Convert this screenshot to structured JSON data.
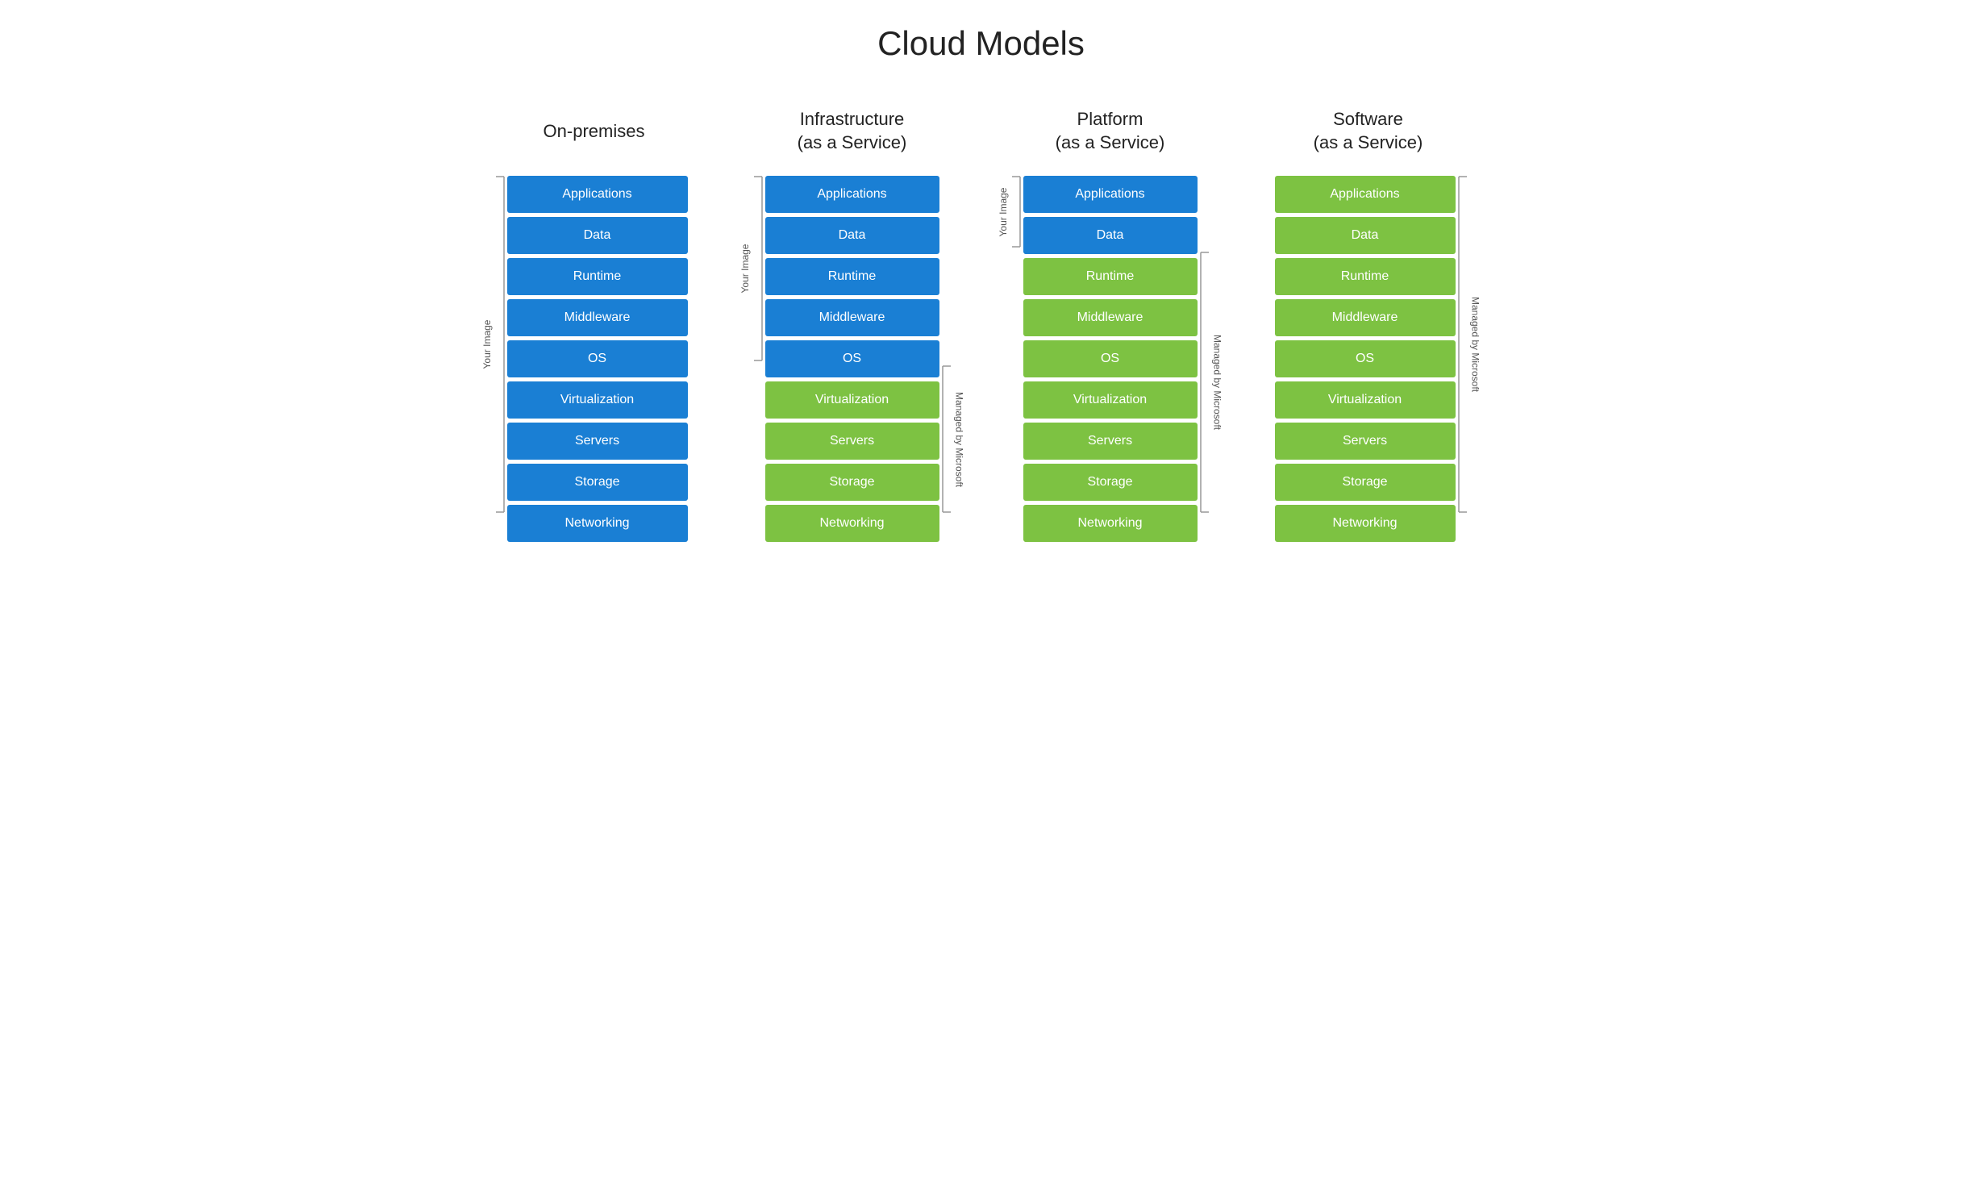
{
  "title": "Cloud Models",
  "colors": {
    "blue": "#1a7fd4",
    "green": "#7dc242",
    "text": "#222222",
    "bracket": "#888888"
  },
  "models": [
    {
      "id": "on-premises",
      "title": "On-premises",
      "left_bracket": {
        "label": "Your Image",
        "start_index": 0,
        "end_index": 8
      },
      "right_bracket": null,
      "layers": [
        {
          "label": "Applications",
          "color": "blue"
        },
        {
          "label": "Data",
          "color": "blue"
        },
        {
          "label": "Runtime",
          "color": "blue"
        },
        {
          "label": "Middleware",
          "color": "blue"
        },
        {
          "label": "OS",
          "color": "blue"
        },
        {
          "label": "Virtualization",
          "color": "blue"
        },
        {
          "label": "Servers",
          "color": "blue"
        },
        {
          "label": "Storage",
          "color": "blue"
        },
        {
          "label": "Networking",
          "color": "blue"
        }
      ]
    },
    {
      "id": "iaas",
      "title": "Infrastructure\n(as a Service)",
      "left_bracket": {
        "label": "Your Image",
        "start_index": 0,
        "end_index": 4
      },
      "right_bracket": {
        "label": "Managed by Microsoft",
        "start_index": 5,
        "end_index": 8
      },
      "layers": [
        {
          "label": "Applications",
          "color": "blue"
        },
        {
          "label": "Data",
          "color": "blue"
        },
        {
          "label": "Runtime",
          "color": "blue"
        },
        {
          "label": "Middleware",
          "color": "blue"
        },
        {
          "label": "OS",
          "color": "blue"
        },
        {
          "label": "Virtualization",
          "color": "green"
        },
        {
          "label": "Servers",
          "color": "green"
        },
        {
          "label": "Storage",
          "color": "green"
        },
        {
          "label": "Networking",
          "color": "green"
        }
      ]
    },
    {
      "id": "paas",
      "title": "Platform\n(as a Service)",
      "left_bracket": {
        "label": "Your Image",
        "start_index": 0,
        "end_index": 1
      },
      "right_bracket": {
        "label": "Managed by Microsoft",
        "start_index": 2,
        "end_index": 8
      },
      "layers": [
        {
          "label": "Applications",
          "color": "blue"
        },
        {
          "label": "Data",
          "color": "blue"
        },
        {
          "label": "Runtime",
          "color": "green"
        },
        {
          "label": "Middleware",
          "color": "green"
        },
        {
          "label": "OS",
          "color": "green"
        },
        {
          "label": "Virtualization",
          "color": "green"
        },
        {
          "label": "Servers",
          "color": "green"
        },
        {
          "label": "Storage",
          "color": "green"
        },
        {
          "label": "Networking",
          "color": "green"
        }
      ]
    },
    {
      "id": "saas",
      "title": "Software\n(as a Service)",
      "left_bracket": null,
      "right_bracket": {
        "label": "Managed by Microsoft",
        "start_index": 0,
        "end_index": 8
      },
      "layers": [
        {
          "label": "Applications",
          "color": "green"
        },
        {
          "label": "Data",
          "color": "green"
        },
        {
          "label": "Runtime",
          "color": "green"
        },
        {
          "label": "Middleware",
          "color": "green"
        },
        {
          "label": "OS",
          "color": "green"
        },
        {
          "label": "Virtualization",
          "color": "green"
        },
        {
          "label": "Servers",
          "color": "green"
        },
        {
          "label": "Storage",
          "color": "green"
        },
        {
          "label": "Networking",
          "color": "green"
        }
      ]
    }
  ]
}
